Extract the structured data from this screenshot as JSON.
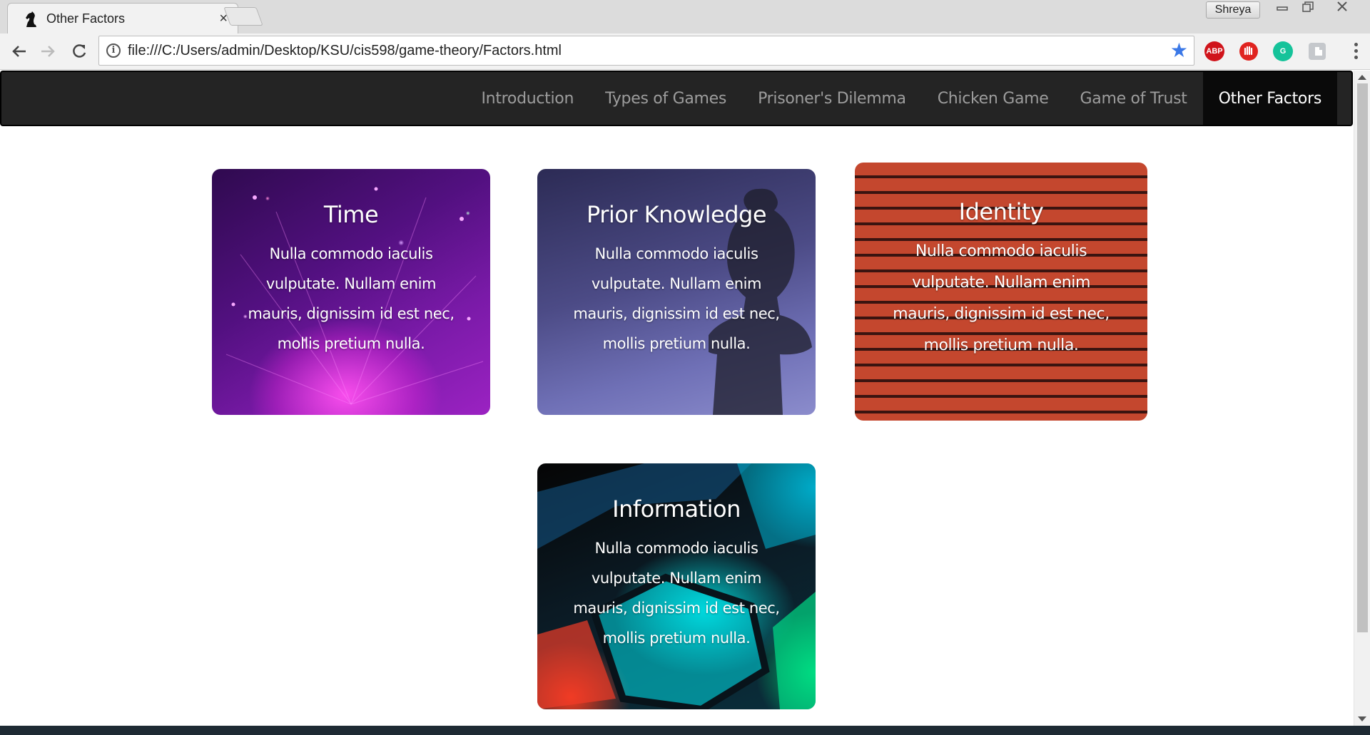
{
  "browser": {
    "tab_title": "Other Factors",
    "tab_close": "×",
    "profile_name": "Shreya",
    "url": "file:///C:/Users/admin/Desktop/KSU/cis598/game-theory/Factors.html",
    "extensions": [
      {
        "name": "adblock-plus-icon",
        "label": "ABP",
        "color": "#d0141b"
      },
      {
        "name": "adblock-hand-icon",
        "label": "",
        "color": "#e0231f"
      },
      {
        "name": "grammarly-icon",
        "label": "G",
        "color": "#15c39a"
      },
      {
        "name": "extension-icon",
        "label": "",
        "color": "#9aa0a6"
      }
    ]
  },
  "nav": {
    "items": [
      {
        "label": "Introduction",
        "active": false
      },
      {
        "label": "Types of Games",
        "active": false
      },
      {
        "label": "Prisoner's Dilemma",
        "active": false
      },
      {
        "label": "Chicken Game",
        "active": false
      },
      {
        "label": "Game of Trust",
        "active": false
      },
      {
        "label": "Other Factors",
        "active": true
      }
    ]
  },
  "cards": [
    {
      "title": "Time",
      "text": "Nulla commodo iaculis vulputate. Nullam enim mauris, dignissim id est nec, mollis pretium nulla."
    },
    {
      "title": "Prior Knowledge",
      "text": "Nulla commodo iaculis vulputate. Nullam enim mauris, dignissim id est nec, mollis pretium nulla."
    },
    {
      "title": "Identity",
      "text": "Nulla commodo iaculis vulputate. Nullam enim mauris, dignissim id est nec, mollis pretium nulla."
    },
    {
      "title": "Information",
      "text": "Nulla commodo iaculis vulputate. Nullam enim mauris, dignissim id est nec, mollis pretium nulla."
    }
  ]
}
